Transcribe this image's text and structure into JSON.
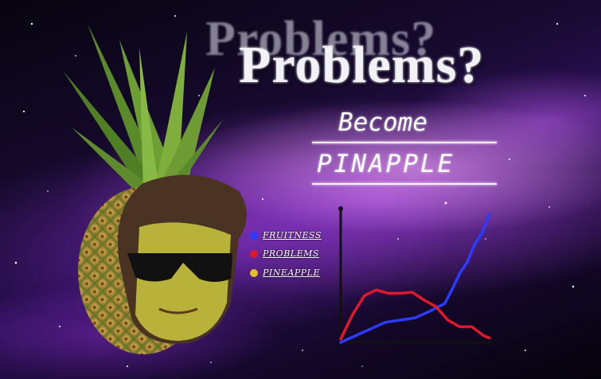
{
  "title": "Problems?",
  "title_echo": "Problems?",
  "subtitle_line1": "Become",
  "subtitle_line2": "PINAPPLE",
  "legend": [
    {
      "label": "FRUITNESS",
      "color": "#2a3cff"
    },
    {
      "label": "PROBLEMS",
      "color": "#e0182c"
    },
    {
      "label": "PINEAPPLE",
      "color": "#e2c028"
    }
  ],
  "chart_data": {
    "type": "line",
    "series": [
      {
        "name": "FRUITNESS",
        "color": "#2a3cff",
        "x": [
          0,
          10,
          20,
          30,
          40,
          50,
          60,
          70,
          75,
          80,
          85,
          90,
          95,
          100
        ],
        "y": [
          0,
          6,
          12,
          18,
          20,
          22,
          28,
          35,
          48,
          62,
          72,
          88,
          98,
          115
        ]
      },
      {
        "name": "PROBLEMS",
        "color": "#e0182c",
        "x": [
          0,
          8,
          16,
          24,
          32,
          40,
          48,
          56,
          64,
          72,
          80,
          88,
          96,
          100
        ],
        "y": [
          3,
          25,
          42,
          47,
          44,
          44,
          45,
          38,
          32,
          20,
          14,
          14,
          6,
          4
        ]
      }
    ],
    "xlim": [
      0,
      100
    ],
    "ylim": [
      0,
      120
    ],
    "grid": false
  }
}
